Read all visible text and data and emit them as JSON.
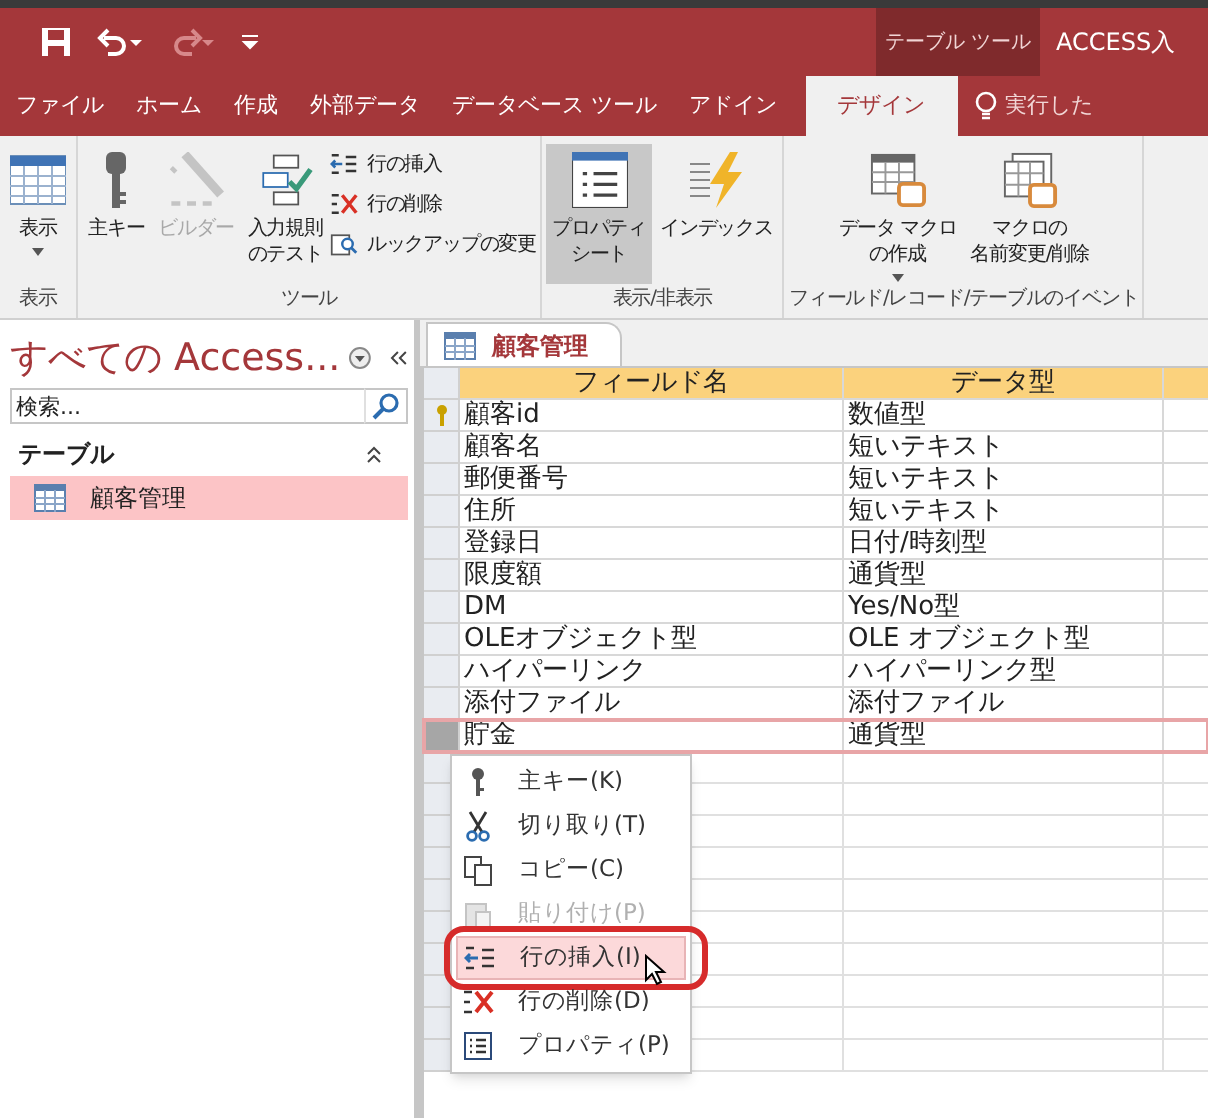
{
  "quick_access": {
    "undo_enabled": true,
    "redo_enabled": false
  },
  "title_bar": {
    "context_label": "テーブル ツール",
    "title": "ACCESS入"
  },
  "ribbon_tabs": [
    {
      "label": "ファイル",
      "selected": false
    },
    {
      "label": "ホーム",
      "selected": false
    },
    {
      "label": "作成",
      "selected": false
    },
    {
      "label": "外部データ",
      "selected": false
    },
    {
      "label": "データベース ツール",
      "selected": false
    },
    {
      "label": "アドイン",
      "selected": false
    },
    {
      "label": "デザイン",
      "selected": true
    }
  ],
  "tell_me": "実行した",
  "ribbon_groups": [
    {
      "label": "表示",
      "buttons": [
        {
          "kind": "view",
          "lines": [
            "表示"
          ],
          "dropdown": true,
          "disabled": false,
          "pressed": false
        }
      ]
    },
    {
      "label": "ツール",
      "buttons": [
        {
          "kind": "key",
          "lines": [
            "主キー"
          ],
          "dropdown": false,
          "disabled": false,
          "pressed": false
        },
        {
          "kind": "builder",
          "lines": [
            "ビルダー"
          ],
          "dropdown": false,
          "disabled": true,
          "pressed": false
        },
        {
          "kind": "test",
          "lines": [
            "入力規則",
            "のテスト"
          ],
          "dropdown": false,
          "disabled": false,
          "pressed": false
        },
        {
          "kind": "small",
          "items": [
            {
              "kind": "insert",
              "label": "行の挿入"
            },
            {
              "kind": "delete",
              "label": "行の削除"
            },
            {
              "kind": "lookup",
              "label": "ルックアップの変更"
            }
          ]
        }
      ]
    },
    {
      "label": "表示/非表示",
      "buttons": [
        {
          "kind": "sheet",
          "lines": [
            "プロパティ",
            "シート"
          ],
          "dropdown": false,
          "disabled": false,
          "pressed": true
        },
        {
          "kind": "index",
          "lines": [
            "インデックス"
          ],
          "dropdown": false,
          "disabled": false,
          "pressed": false
        }
      ]
    },
    {
      "label": "フィールド/レコード/テーブルのイベント",
      "buttons": [
        {
          "kind": "macro",
          "lines": [
            "データ マクロ",
            "の作成"
          ],
          "dropdown": true,
          "disabled": false,
          "pressed": false
        },
        {
          "kind": "rename",
          "lines": [
            "マクロの",
            "名前変更/削除"
          ],
          "dropdown": false,
          "disabled": false,
          "pressed": false
        }
      ]
    }
  ],
  "nav_pane": {
    "title": "すべての Access...",
    "search_placeholder": "検索...",
    "section": "テーブル",
    "items": [
      {
        "label": "顧客管理",
        "selected": true
      }
    ]
  },
  "document_tab": {
    "label": "顧客管理"
  },
  "table": {
    "columns": [
      "フィールド名",
      "データ型"
    ],
    "rows": [
      {
        "field": "顧客id",
        "type": "数値型",
        "primary_key": true,
        "selected": false
      },
      {
        "field": "顧客名",
        "type": "短いテキスト",
        "primary_key": false,
        "selected": false
      },
      {
        "field": "郵便番号",
        "type": "短いテキスト",
        "primary_key": false,
        "selected": false
      },
      {
        "field": "住所",
        "type": "短いテキスト",
        "primary_key": false,
        "selected": false
      },
      {
        "field": "登録日",
        "type": "日付/時刻型",
        "primary_key": false,
        "selected": false
      },
      {
        "field": "限度額",
        "type": "通貨型",
        "primary_key": false,
        "selected": false
      },
      {
        "field": "DM",
        "type": "Yes/No型",
        "primary_key": false,
        "selected": false
      },
      {
        "field": "OLEオブジェクト型",
        "type": "OLE オブジェクト型",
        "primary_key": false,
        "selected": false
      },
      {
        "field": "ハイパーリンク",
        "type": "ハイパーリンク型",
        "primary_key": false,
        "selected": false
      },
      {
        "field": "添付ファイル",
        "type": "添付ファイル",
        "primary_key": false,
        "selected": false
      },
      {
        "field": "貯金",
        "type": "通貨型",
        "primary_key": false,
        "selected": true
      }
    ]
  },
  "context_menu": [
    {
      "kind": "key",
      "label": "主キー(K)",
      "disabled": false,
      "highlighted": false
    },
    {
      "kind": "cut",
      "label": "切り取り(T)",
      "disabled": false,
      "highlighted": false
    },
    {
      "kind": "copy",
      "label": "コピー(C)",
      "disabled": false,
      "highlighted": false
    },
    {
      "kind": "paste",
      "label": "貼り付け(P)",
      "disabled": true,
      "highlighted": false
    },
    {
      "kind": "insert",
      "label": "行の挿入(I)",
      "disabled": false,
      "highlighted": true
    },
    {
      "kind": "delete",
      "label": "行の削除(D)",
      "disabled": false,
      "highlighted": false
    },
    {
      "kind": "properties",
      "label": "プロパティ(P)",
      "disabled": false,
      "highlighted": false
    }
  ]
}
